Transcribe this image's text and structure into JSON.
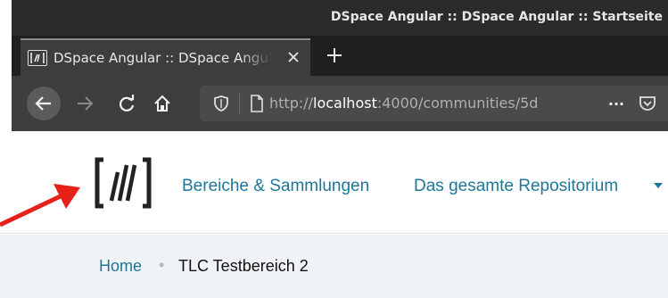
{
  "browser": {
    "window_title": "DSpace Angular :: DSpace Angular :: Startseite",
    "tab": {
      "title": "DSpace Angular :: DSpace Angular :: Startseite"
    },
    "url": {
      "prefix": "http://",
      "host": "localhost",
      "rest": ":4000/communities/5d",
      "full": "http://localhost:4000/communities/5d"
    },
    "toolbar_more": "···"
  },
  "page": {
    "nav": {
      "communities_label": "Bereiche & Sammlungen",
      "browse_label": "Das gesamte Repositorium"
    },
    "breadcrumb": {
      "home": "Home",
      "separator": "•",
      "current": "TLC Testbereich 2"
    }
  },
  "colors": {
    "link": "#207698",
    "breadcrumb_bg": "#f0f3f5",
    "annotation_arrow": "#e8201a"
  },
  "icons": [
    "dspace-favicon",
    "close-icon",
    "plus-icon",
    "back-arrow-icon",
    "forward-arrow-icon",
    "reload-icon",
    "home-icon",
    "shield-icon",
    "page-icon",
    "more-icon",
    "pocket-icon",
    "dspace-logo",
    "caret-down-icon",
    "red-arrow-annotation"
  ]
}
